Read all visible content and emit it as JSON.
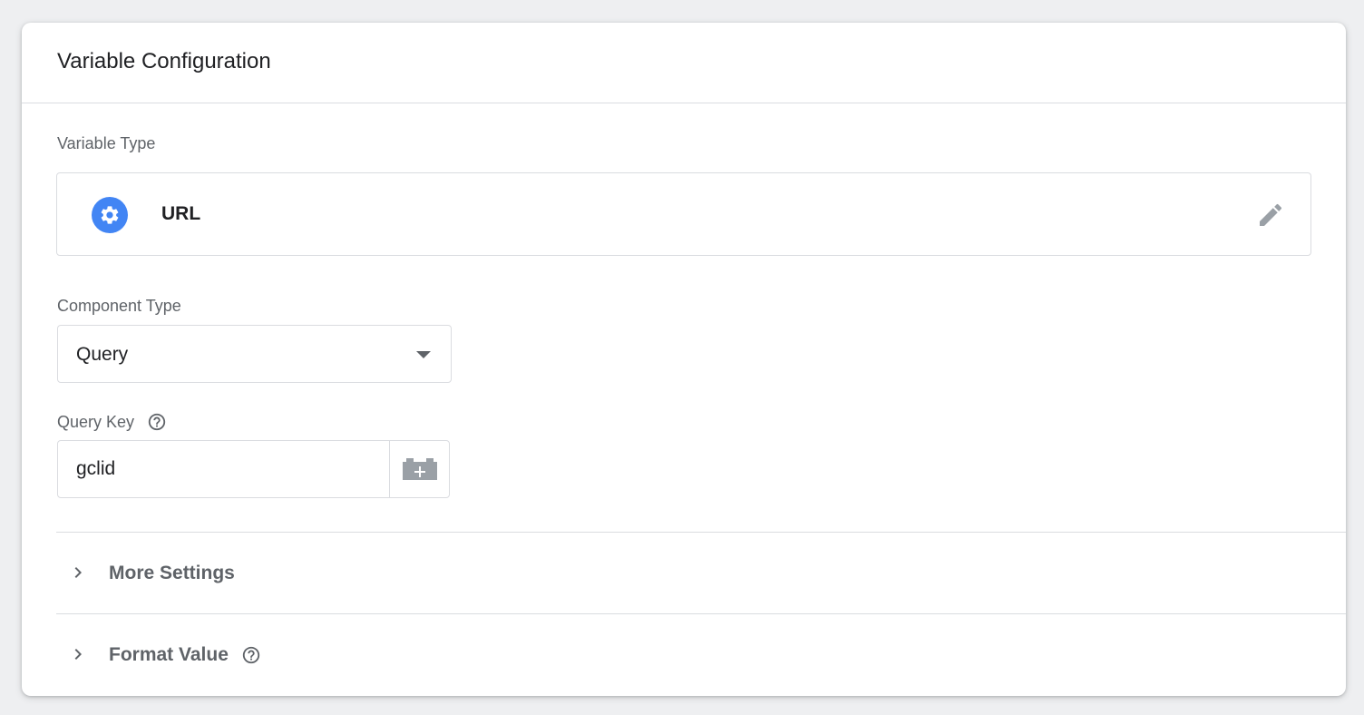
{
  "card": {
    "title": "Variable Configuration"
  },
  "variable_type": {
    "label": "Variable Type",
    "value": "URL",
    "icon": "gear-icon",
    "edit_icon": "pencil-icon",
    "icon_color": "#4285f4"
  },
  "component_type": {
    "label": "Component Type",
    "selected": "Query"
  },
  "query_key": {
    "label": "Query Key",
    "value": "gclid",
    "help_icon": "help-circle-icon",
    "variable_button_icon": "add-variable-icon"
  },
  "sections": [
    {
      "label": "More Settings",
      "has_help": false
    },
    {
      "label": "Format Value",
      "has_help": true
    }
  ]
}
